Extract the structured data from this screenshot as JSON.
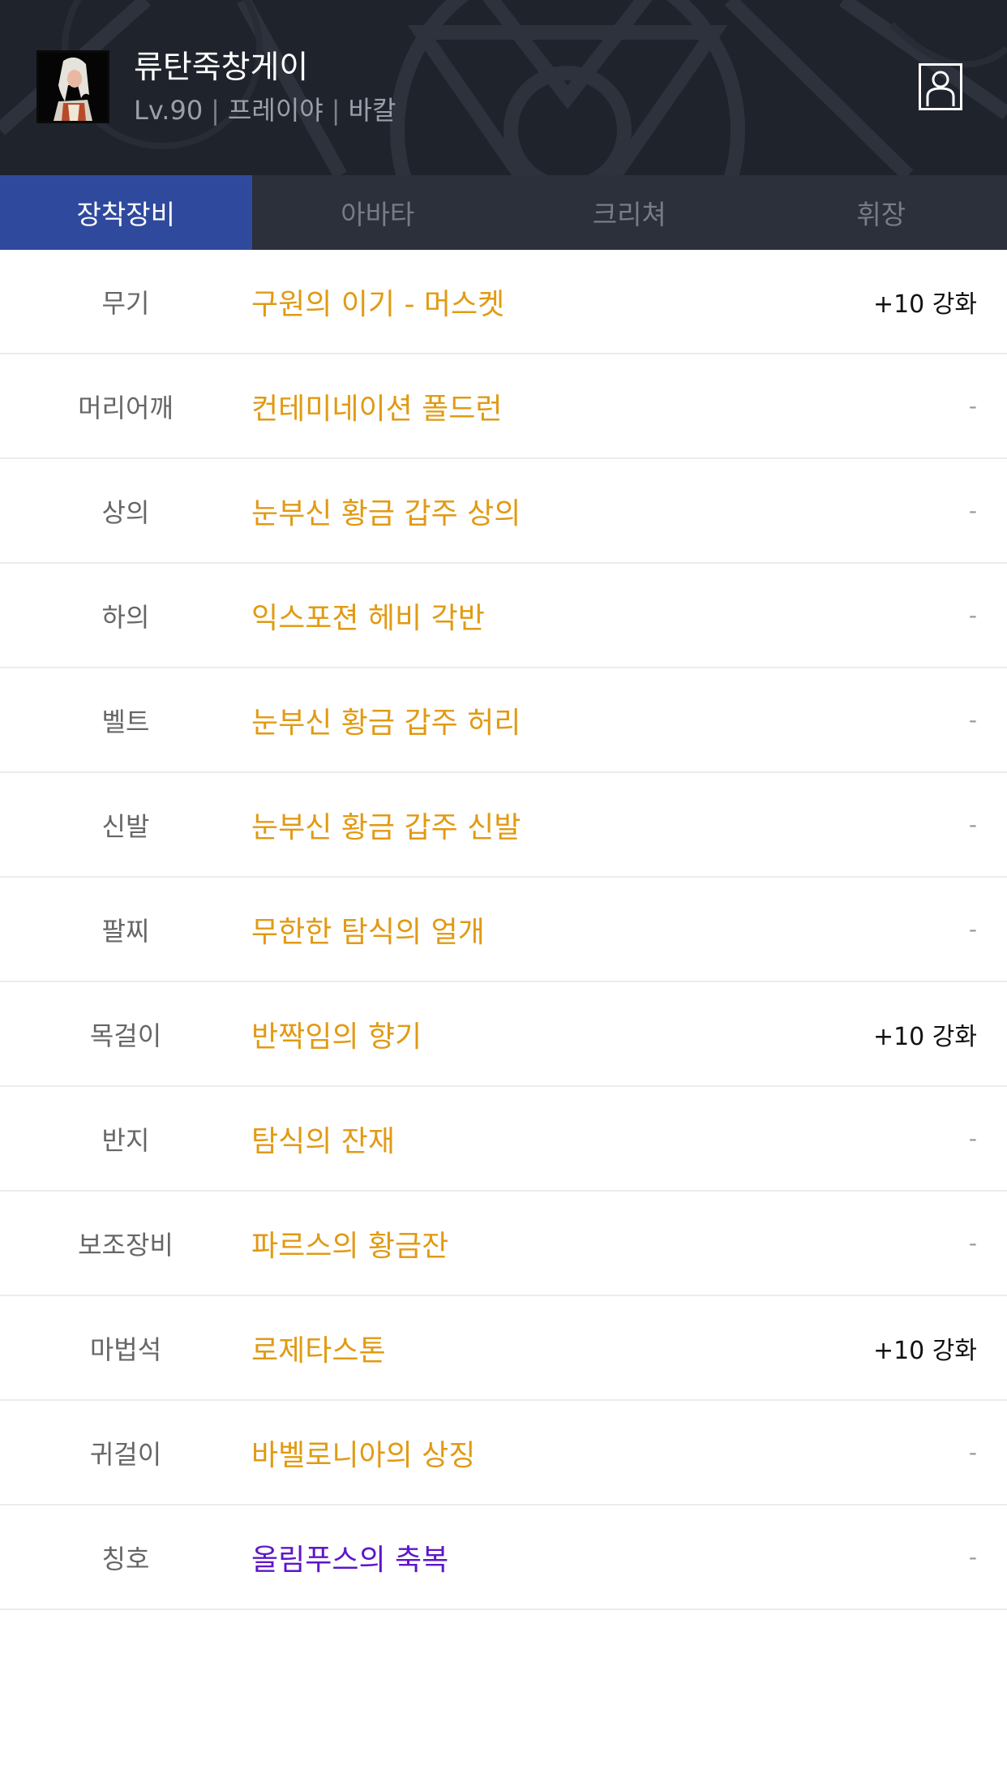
{
  "character": {
    "name": "류탄죽창게이",
    "level": "Lv.90",
    "class": "프레이야",
    "server": "바칼",
    "avatar_icon": "character-portrait-icon",
    "profile_icon": "person-icon"
  },
  "colors": {
    "header_bg": "#1f232b",
    "tab_bar_bg": "#2b303a",
    "active_tab_bg": "#2f4a9d",
    "item_gold": "#e19a13",
    "item_purple": "#5d16c9"
  },
  "tabs": [
    {
      "label": "장착장비",
      "active": true
    },
    {
      "label": "아바타",
      "active": false
    },
    {
      "label": "크리쳐",
      "active": false
    },
    {
      "label": "휘장",
      "active": false
    }
  ],
  "equipment": [
    {
      "slot": "무기",
      "item": "구원의 이기 - 머스켓",
      "enhance": "+10 강화",
      "color": "#e19a13"
    },
    {
      "slot": "머리어깨",
      "item": "컨테미네이션 폴드런",
      "enhance": "-",
      "color": "#e19a13"
    },
    {
      "slot": "상의",
      "item": "눈부신 황금 갑주 상의",
      "enhance": "-",
      "color": "#e19a13"
    },
    {
      "slot": "하의",
      "item": "익스포젼 헤비 각반",
      "enhance": "-",
      "color": "#e19a13"
    },
    {
      "slot": "벨트",
      "item": "눈부신 황금 갑주 허리",
      "enhance": "-",
      "color": "#e19a13"
    },
    {
      "slot": "신발",
      "item": "눈부신 황금 갑주 신발",
      "enhance": "-",
      "color": "#e19a13"
    },
    {
      "slot": "팔찌",
      "item": "무한한 탐식의 얼개",
      "enhance": "-",
      "color": "#e19a13"
    },
    {
      "slot": "목걸이",
      "item": "반짝임의 향기",
      "enhance": "+10 강화",
      "color": "#e19a13"
    },
    {
      "slot": "반지",
      "item": "탐식의 잔재",
      "enhance": "-",
      "color": "#e19a13"
    },
    {
      "slot": "보조장비",
      "item": "파르스의 황금잔",
      "enhance": "-",
      "color": "#e19a13"
    },
    {
      "slot": "마법석",
      "item": "로제타스톤",
      "enhance": "+10 강화",
      "color": "#e19a13"
    },
    {
      "slot": "귀걸이",
      "item": "바벨로니아의 상징",
      "enhance": "-",
      "color": "#e19a13"
    },
    {
      "slot": "칭호",
      "item": "올림푸스의 축복",
      "enhance": "-",
      "color": "#5d16c9"
    }
  ]
}
